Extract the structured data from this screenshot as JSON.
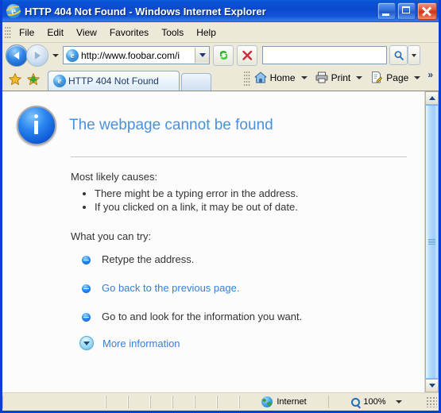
{
  "window": {
    "title": "HTTP 404 Not Found - Windows Internet Explorer",
    "app_icon": "ie-logo-icon",
    "controls": {
      "minimize": "Minimize",
      "maximize": "Maximize",
      "close": "Close"
    }
  },
  "menubar": {
    "items": [
      {
        "label": "File"
      },
      {
        "label": "Edit"
      },
      {
        "label": "View"
      },
      {
        "label": "Favorites"
      },
      {
        "label": "Tools"
      },
      {
        "label": "Help"
      }
    ]
  },
  "toolbar": {
    "back": "Back",
    "forward": "Forward",
    "history_dropdown": "Recent Pages",
    "address": {
      "value": "http://www.foobar.com/i",
      "placeholder": "Address"
    },
    "refresh": "Refresh",
    "stop": "Stop",
    "search": {
      "value": "",
      "placeholder": ""
    },
    "search_go": "Search",
    "search_dropdown": "Search Options"
  },
  "tabbar": {
    "favorites_center": "Favorites Center",
    "add_to_favorites": "Add to Favorites",
    "tabs": [
      {
        "label": "HTTP 404 Not Found",
        "active": true
      }
    ],
    "new_tab": "New Tab",
    "commands": [
      {
        "label": "Home",
        "icon": "home-icon",
        "has_dropdown": true
      },
      {
        "label": "Print",
        "icon": "printer-icon",
        "has_dropdown": true
      },
      {
        "label": "Page",
        "icon": "page-icon",
        "has_dropdown": true
      }
    ],
    "overflow": "»"
  },
  "page": {
    "icon": "info-icon",
    "title": "The webpage cannot be found",
    "causes_heading": "Most likely causes:",
    "causes": [
      "There might be a typing error in the address.",
      "If you clicked on a link, it may be out of date."
    ],
    "try_heading": "What you can try:",
    "actions": [
      {
        "text": "Retype the address.",
        "is_link": false
      },
      {
        "text": "Go back to the previous page.",
        "is_link": true
      },
      {
        "text": "Go to  and look for the information you want.",
        "is_link": false
      }
    ],
    "more_information": "More information"
  },
  "scrollbar": {
    "up": "Scroll Up",
    "down": "Scroll Down",
    "thumb": "Scroll Thumb"
  },
  "statusbar": {
    "zone": "Internet",
    "zone_icon": "globe-icon",
    "zoom": "100%",
    "zoom_icon": "zoom-icon"
  },
  "colors": {
    "titlebar": "#0c49cf",
    "chrome": "#ece9d8",
    "heading": "#4a90e2",
    "link": "#3a7fd5",
    "close_button": "#d23414"
  }
}
